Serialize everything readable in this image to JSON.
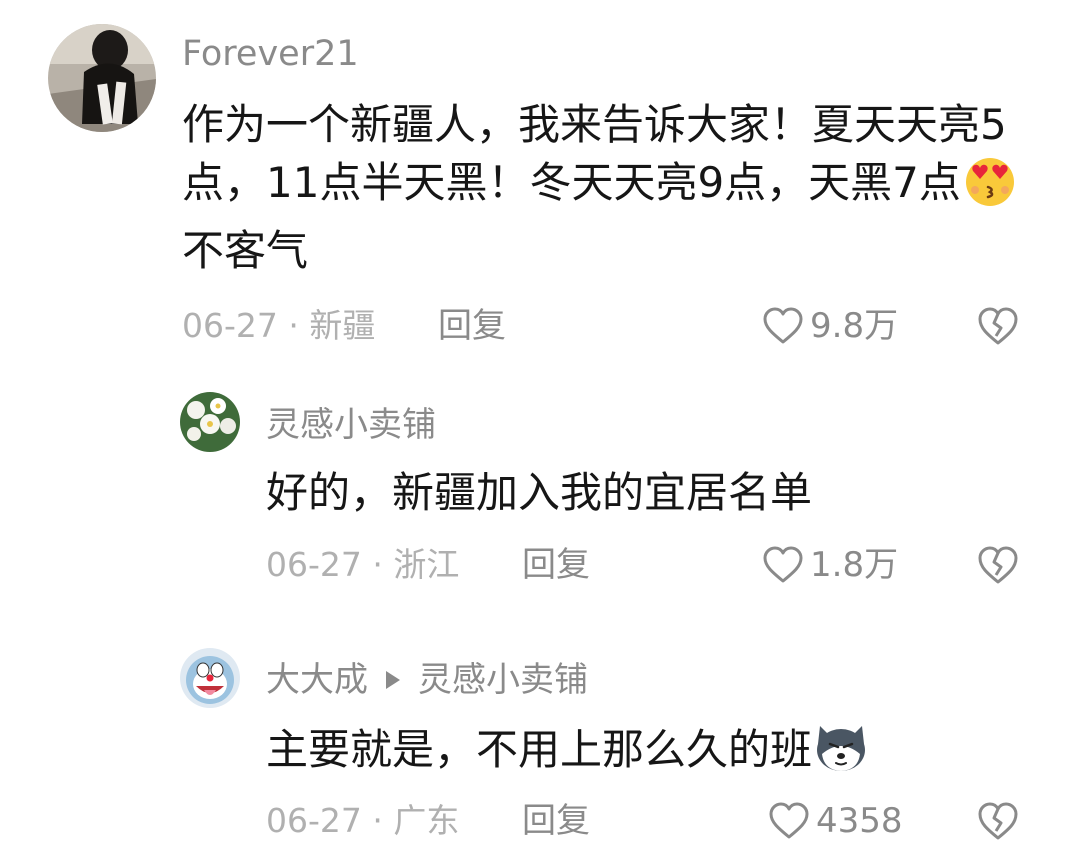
{
  "comments": [
    {
      "user": "Forever21",
      "text": "作为一个新疆人，我来告诉大家！夏天天亮5点，11点半天黑！冬天天亮9点，天黑7点",
      "emoji": "kissing-heart-eyes-emoji",
      "text_after_emoji": "不客气",
      "date": "06-27",
      "location": "新疆",
      "reply_label": "回复",
      "likes": "9.8万"
    },
    {
      "user": "灵感小卖铺",
      "text": "好的，新疆加入我的宜居名单",
      "date": "06-27",
      "location": "浙江",
      "reply_label": "回复",
      "likes": "1.8万"
    },
    {
      "user": "大大成",
      "reply_to": "灵感小卖铺",
      "text": "主要就是，不用上那么久的班",
      "emoji": "husky-dog-emoji",
      "date": "06-27",
      "location": "广东",
      "reply_label": "回复",
      "likes": "4358"
    }
  ],
  "meta_separator": "·",
  "colors": {
    "text": "#161616",
    "secondary": "#8a8a8a",
    "muted": "#b0b0b0",
    "heart_red": "#e8253a"
  }
}
